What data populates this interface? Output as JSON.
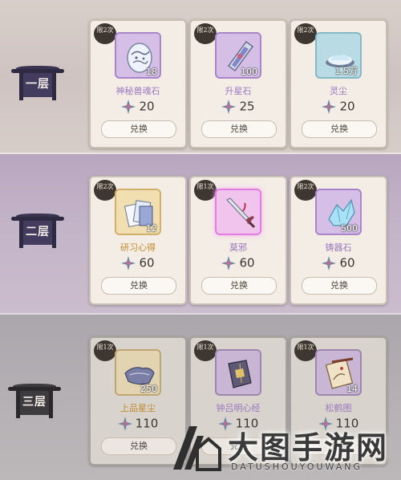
{
  "currency_icon": "star-flower-icon",
  "tiers": [
    {
      "badge": "一层",
      "items": [
        {
          "limit": "限2次",
          "name": "神秘兽魂石",
          "qty": "18",
          "price": "20",
          "button": "兑换",
          "icon": "spirit-stone-icon",
          "rarity": "purple"
        },
        {
          "limit": "限2次",
          "name": "升星石",
          "qty": "100",
          "price": "25",
          "button": "兑换",
          "icon": "star-rise-stone-icon",
          "rarity": "purple"
        },
        {
          "limit": "限2次",
          "name": "灵尘",
          "qty": "1.5万",
          "price": "20",
          "button": "兑换",
          "icon": "spirit-dust-icon",
          "rarity": "blue"
        }
      ]
    },
    {
      "badge": "二层",
      "items": [
        {
          "limit": "限2次",
          "name": "研习心得",
          "qty": "12",
          "price": "60",
          "button": "兑换",
          "icon": "study-notes-icon",
          "rarity": "gold"
        },
        {
          "limit": "限1次",
          "name": "莫邪",
          "qty": "",
          "price": "60",
          "button": "兑换",
          "icon": "sword-icon",
          "rarity": "pink"
        },
        {
          "limit": "限2次",
          "name": "铸器石",
          "qty": "500",
          "price": "60",
          "button": "兑换",
          "icon": "forge-crystal-icon",
          "rarity": "purple"
        }
      ]
    },
    {
      "badge": "三层",
      "items": [
        {
          "limit": "限1次",
          "name": "上品星尘",
          "qty": "250",
          "price": "110",
          "button": "兑换",
          "icon": "stardust-icon",
          "rarity": "gold"
        },
        {
          "limit": "限1次",
          "name": "钟吕明心经",
          "qty": "",
          "price": "110",
          "button": "兑换",
          "icon": "scripture-icon",
          "rarity": "purple"
        },
        {
          "limit": "限1次",
          "name": "松鹤图",
          "qty": "14",
          "price": "110",
          "button": "兑换",
          "icon": "scroll-painting-icon",
          "rarity": "purple"
        }
      ]
    }
  ],
  "watermark": {
    "title": "大图手游网",
    "subtitle": "DATUSHOUYOUWANG"
  },
  "colors": {
    "purple_name": "#9c77be",
    "gold_name": "#c08a2a",
    "accent_pink": "#e07fdd"
  }
}
